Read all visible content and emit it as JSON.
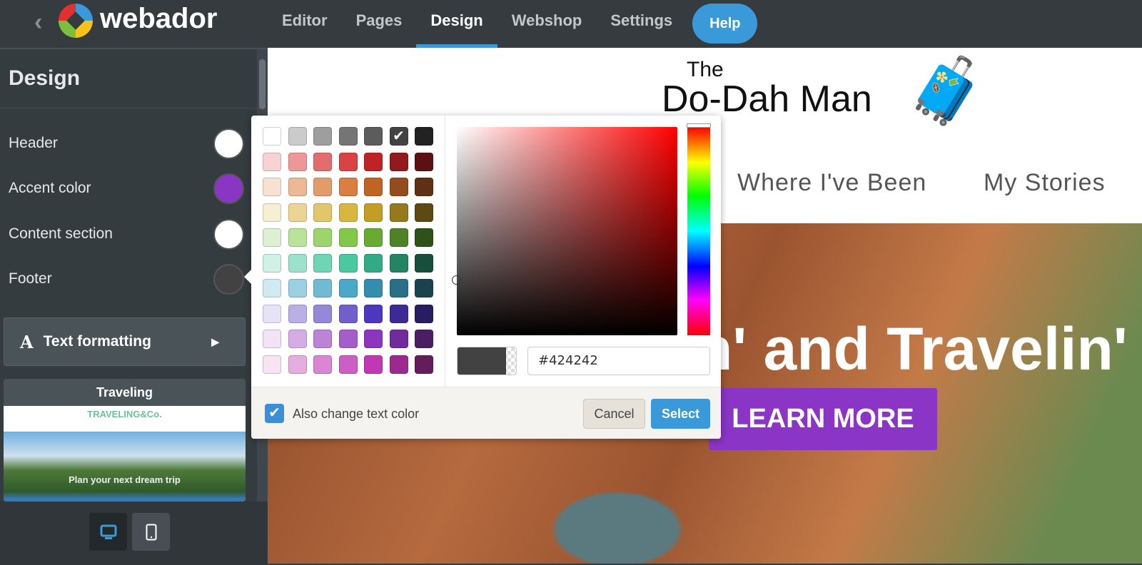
{
  "topbar": {
    "brand": "webador",
    "nav": [
      "Editor",
      "Pages",
      "Design",
      "Webshop",
      "Settings"
    ],
    "active": "Design",
    "help": "Help"
  },
  "sidebar": {
    "title": "Design",
    "rows": [
      {
        "label": "Header",
        "color": "#ffffff"
      },
      {
        "label": "Accent color",
        "color": "#8a35c6"
      },
      {
        "label": "Content section",
        "color": "#ffffff"
      },
      {
        "label": "Footer",
        "color": "#424242"
      }
    ],
    "text_formatting": "Text formatting",
    "theme": {
      "name": "Traveling",
      "logo": "TRAVELING&Co.",
      "tagline": "Plan your next dream trip"
    }
  },
  "preview": {
    "site_title_small": "The",
    "site_title": "Do-Dah Man",
    "menu": [
      "Where I've Been",
      "My Stories"
    ],
    "hero_heading": "n' and Travelin'",
    "cta": "LEARN MORE",
    "accent": "#8a35c6"
  },
  "picker": {
    "selected": "#424242",
    "hex_value": "#424242",
    "also_change_text": "Also change text color",
    "also_change_checked": true,
    "cancel": "Cancel",
    "select": "Select",
    "palette": [
      [
        "#ffffff",
        "#cbcbcb",
        "#9e9e9e",
        "#757575",
        "#5c5c5c",
        "#424242",
        "#222222"
      ],
      [
        "#f7d2d3",
        "#ed9798",
        "#e36c6d",
        "#da4243",
        "#c02325",
        "#921a1d",
        "#5c1011"
      ],
      [
        "#f7e1d3",
        "#ecb994",
        "#e39b6c",
        "#da7e42",
        "#c06424",
        "#944b1e",
        "#602f14"
      ],
      [
        "#f7efd2",
        "#ecd594",
        "#e2c66b",
        "#d8b640",
        "#c29e24",
        "#947a1c",
        "#5c4a12"
      ],
      [
        "#ddf0d1",
        "#b9e398",
        "#9dd56c",
        "#82c84a",
        "#67ab32",
        "#4d8326",
        "#2e5218"
      ],
      [
        "#d1f0e6",
        "#9ae2cb",
        "#6ed5b5",
        "#4bc89f",
        "#31ab85",
        "#248565",
        "#174f3c"
      ],
      [
        "#d1e9f0",
        "#9bcfe2",
        "#70bbd3",
        "#4aa8c8",
        "#338dae",
        "#286f87",
        "#1a4350"
      ],
      [
        "#e6e3f7",
        "#bab0e6",
        "#9688d9",
        "#725fcb",
        "#4e37c0",
        "#3d2a96",
        "#281d62"
      ],
      [
        "#f2e3f7",
        "#d5ace6",
        "#bc84d6",
        "#a45dcb",
        "#8c36c0",
        "#712b9a",
        "#4b1d63"
      ],
      [
        "#f7e3f2",
        "#e6ade0",
        "#da86d3",
        "#cc5ec4",
        "#c237b3",
        "#9a2a8e",
        "#641c5c"
      ]
    ]
  }
}
